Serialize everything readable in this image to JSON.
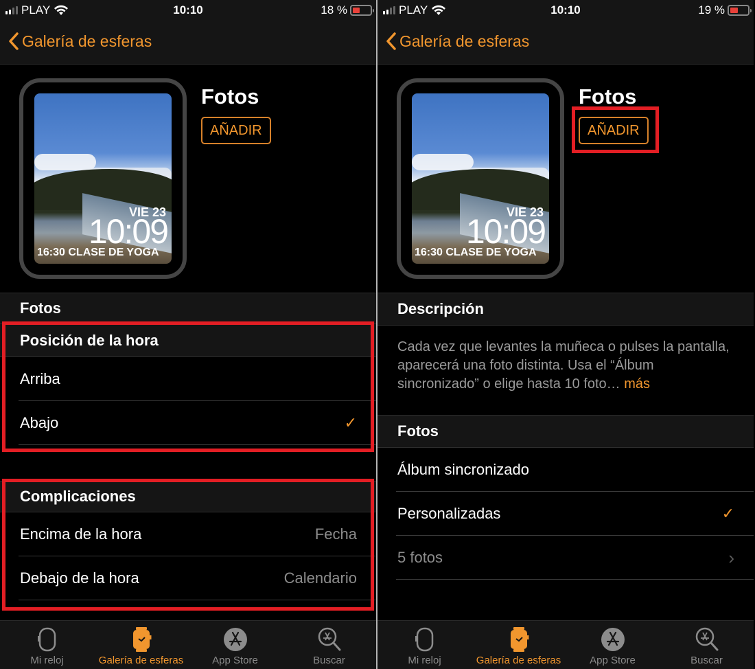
{
  "screens": [
    {
      "status": {
        "carrier": "PLAY",
        "time": "10:10",
        "battery_text": "18 %",
        "battery_level": 0.18
      },
      "nav": {
        "back_label": "Galería de esferas"
      },
      "hero": {
        "title": "Fotos",
        "add_label": "AÑADIR",
        "face": {
          "date": "VIE 23",
          "time": "10:09",
          "event": "16:30 CLASE DE YOGA"
        }
      },
      "sections": {
        "fotos_header": "Fotos",
        "position": {
          "header": "Posición de la hora",
          "options": [
            {
              "label": "Arriba",
              "selected": false
            },
            {
              "label": "Abajo",
              "selected": true
            }
          ]
        },
        "complications": {
          "header": "Complicaciones",
          "rows": [
            {
              "label": "Encima de la hora",
              "value": "Fecha"
            },
            {
              "label": "Debajo de la hora",
              "value": "Calendario"
            }
          ]
        }
      }
    },
    {
      "status": {
        "carrier": "PLAY",
        "time": "10:10",
        "battery_text": "19 %",
        "battery_level": 0.19
      },
      "nav": {
        "back_label": "Galería de esferas"
      },
      "hero": {
        "title": "Fotos",
        "add_label": "AÑADIR",
        "face": {
          "date": "VIE 23",
          "time": "10:09",
          "event": "16:30 CLASE DE YOGA"
        }
      },
      "sections": {
        "description": {
          "header": "Descripción",
          "text": "Cada vez que levantes la muñeca o pulses la pantalla, aparecerá una foto distinta. Usa el “Álbum sincronizado” o elige hasta 10 foto…",
          "more_label": "más"
        },
        "photos": {
          "header": "Fotos",
          "options": [
            {
              "label": "Álbum sincronizado",
              "selected": false
            },
            {
              "label": "Personalizadas",
              "selected": true
            }
          ],
          "link": {
            "label": "5 fotos"
          }
        }
      }
    }
  ],
  "tabbar": {
    "items": [
      {
        "label": "Mi reloj",
        "icon": "watch-outline-icon",
        "active": false
      },
      {
        "label": "Galería de esferas",
        "icon": "watch-face-gallery-icon",
        "active": true
      },
      {
        "label": "App Store",
        "icon": "app-store-icon",
        "active": false
      },
      {
        "label": "Buscar",
        "icon": "search-icon",
        "active": false
      }
    ]
  },
  "symbols": {
    "check": "✓",
    "chevron": "›"
  },
  "colors": {
    "accent": "#f1962e",
    "highlight": "#e31e24",
    "battery_low": "#e8413a"
  }
}
